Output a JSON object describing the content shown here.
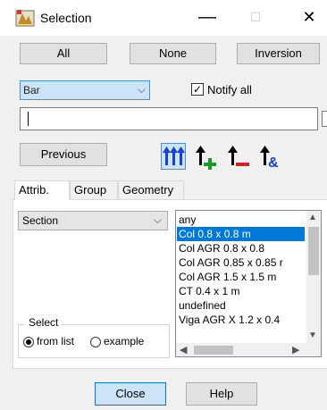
{
  "window": {
    "title": "Selection",
    "minimize": "—",
    "maximize": "☐",
    "close": "✕"
  },
  "toolbar": {
    "all_label": "All",
    "none_label": "None",
    "inversion_label": "Inversion"
  },
  "filter": {
    "type_value": "Bar",
    "notify_all_label": "Notify all",
    "notify_all_checked": true,
    "text_value": ""
  },
  "actions": {
    "previous_label": "Previous",
    "tools": [
      {
        "name": "select-all-icon",
        "active": true
      },
      {
        "name": "add-selection-icon",
        "active": false
      },
      {
        "name": "remove-selection-icon",
        "active": false
      },
      {
        "name": "intersect-selection-icon",
        "active": false
      }
    ]
  },
  "tabs": [
    "Attrib.",
    "Group",
    "Geometry"
  ],
  "attrib": {
    "property_value": "Section",
    "select_group_label": "Select",
    "from_list_label": "from list",
    "example_label": "example",
    "from_list_selected": true
  },
  "list": {
    "items": [
      "any",
      "Col 0.8 x 0.8 m",
      "Col AGR 0.8 x 0.8",
      "Col AGR 0.85 x 0.85 r",
      "Col AGR 1.5 x 1.5 m",
      "CT 0.4 x 1 m",
      "undefined",
      "Viga AGR X 1.2 x 0.4"
    ],
    "selected_index": 1
  },
  "footer": {
    "close_label": "Close",
    "help_label": "Help"
  },
  "colors": {
    "selection": "#0078d7",
    "add_icon": "#1a9a2a",
    "remove_icon": "#d22222",
    "and_icon": "#1a3fd8"
  }
}
